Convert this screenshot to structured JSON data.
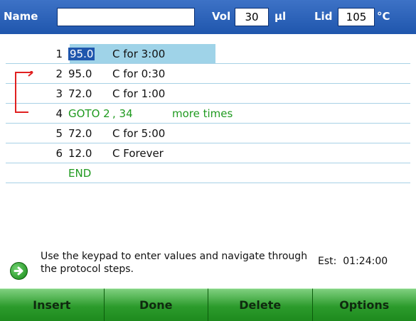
{
  "header": {
    "name_label": "Name",
    "name_value": "",
    "vol_label": "Vol",
    "vol_value": "30",
    "vol_unit": "µl",
    "lid_label": "Lid",
    "lid_value": "105",
    "lid_unit": "°C"
  },
  "steps": [
    {
      "num": "1",
      "temp": "95.0",
      "desc": "C for 3:00"
    },
    {
      "num": "2",
      "temp": "95.0",
      "desc": "C for 0:30"
    },
    {
      "num": "3",
      "temp": "72.0",
      "desc": "C for 1:00"
    },
    {
      "num": "4",
      "goto": "GOTO 2",
      "times": ", 34",
      "more": "more times"
    },
    {
      "num": "5",
      "temp": "72.0",
      "desc": "C for 5:00"
    },
    {
      "num": "6",
      "temp": "12.0",
      "desc": "C Forever"
    },
    {
      "end": "END"
    }
  ],
  "hint": {
    "icon": "arrow-right-circle-icon",
    "text": "Use the keypad to enter values and navigate through the protocol steps."
  },
  "estimate": {
    "label": "Est:",
    "value": "01:24:00"
  },
  "buttons": [
    "Insert",
    "Done",
    "Delete",
    "Options"
  ],
  "colors": {
    "header": "#2a62b8",
    "selection": "#9fd3e8",
    "goto_text": "#1f9a1f",
    "buttons": "#2c9b2c",
    "bracket": "#e02020"
  }
}
